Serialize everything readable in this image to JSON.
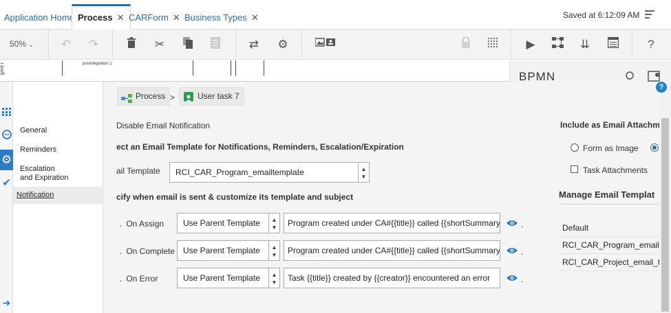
{
  "tabs": [
    {
      "label": "Application Home",
      "closable": false,
      "active": false
    },
    {
      "label": "Process",
      "closable": true,
      "active": true
    },
    {
      "label": "CARForm",
      "closable": true,
      "active": false
    },
    {
      "label": "Business Types",
      "closable": true,
      "active": false
    }
  ],
  "close_glyph": "✕",
  "status": {
    "saved": "Saved at 6:12:09 AM"
  },
  "toolbar": {
    "zoom": "50%"
  },
  "canvas": {
    "lane_label": "gred r",
    "element_label": "posintegration 1"
  },
  "right_panel": {
    "title": "BPMN"
  },
  "nav": {
    "items": [
      {
        "label": "General"
      },
      {
        "label": "Reminders"
      },
      {
        "label": "Escalation\nand Expiration"
      },
      {
        "label": "Notification"
      }
    ]
  },
  "breadcrumb": {
    "root": "Process",
    "separator": ">",
    "current": "User task 7"
  },
  "notification": {
    "disable_label": "Disable Email Notification",
    "select_template_heading": "ect an Email Template for Notifications, Reminders, Escalation/Expiration",
    "email_template_label": "ail Template",
    "email_template_value": "RCI_CAR_Program_emailtemplate",
    "specify_heading": "cify when email is sent & customize its template and subject",
    "rows": [
      {
        "label": "On Assign",
        "template": "Use Parent Template",
        "subject": "Program created under CA#{{title}} called {{shortSummary}"
      },
      {
        "label": "On Complete",
        "template": "Use Parent Template",
        "subject": "Program created under CA#{{title}} called {{shortSummary}"
      },
      {
        "label": "On Error",
        "template": "Use Parent Template",
        "subject": "Task {{title}} created by {{creator}} encountered an error"
      }
    ],
    "attachment": {
      "heading": "Include as Email Attachme",
      "form_as_image": "Form as Image",
      "task_attachments": "Task Attachments"
    },
    "manage": {
      "heading": "Manage Email Templat",
      "templates": [
        "Default",
        "RCI_CAR_Program_emailt",
        "RCI_CAR_Project_email_te"
      ]
    }
  },
  "colors": {
    "accent": "#2a6ea8",
    "link": "#2a7dc4"
  }
}
